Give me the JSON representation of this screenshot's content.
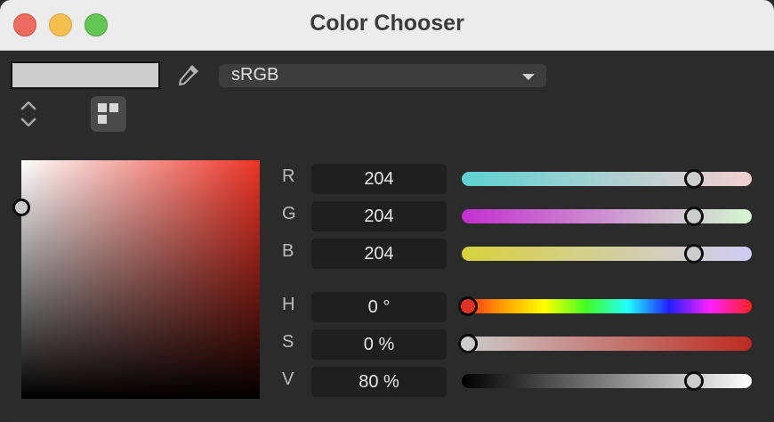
{
  "window": {
    "title": "Color Chooser",
    "traffic_lights": {
      "close": "#ed6a5e",
      "minimize": "#f5bf4f",
      "zoom": "#62c554"
    }
  },
  "toolbar": {
    "swatch_color": "#cccccc",
    "eyedropper_icon": "eyedropper-icon",
    "color_space": "sRGB"
  },
  "picker": {
    "mode_stepper_icon": "up-down-chevron-icon",
    "palette_icon": "palette-grid-icon",
    "hue_color": "#ec3325",
    "handle_color": "#cccccc"
  },
  "rgb": {
    "r": {
      "label": "R",
      "value": "204"
    },
    "g": {
      "label": "G",
      "value": "204"
    },
    "b": {
      "label": "B",
      "value": "204"
    }
  },
  "hsv": {
    "h": {
      "label": "H",
      "value": "0 °"
    },
    "s": {
      "label": "S",
      "value": "0 %"
    },
    "v": {
      "label": "V",
      "value": "80 %"
    }
  },
  "slider_levels": {
    "r": 0.8,
    "g": 0.8,
    "b": 0.8,
    "h": 0.0,
    "s": 0.0,
    "v": 0.8
  },
  "thumb_colors": {
    "r": "#cccccc",
    "g": "#cccccc",
    "b": "#cccccc",
    "h": "#e53225",
    "s": "#cccccc",
    "v": "#cccccc"
  }
}
